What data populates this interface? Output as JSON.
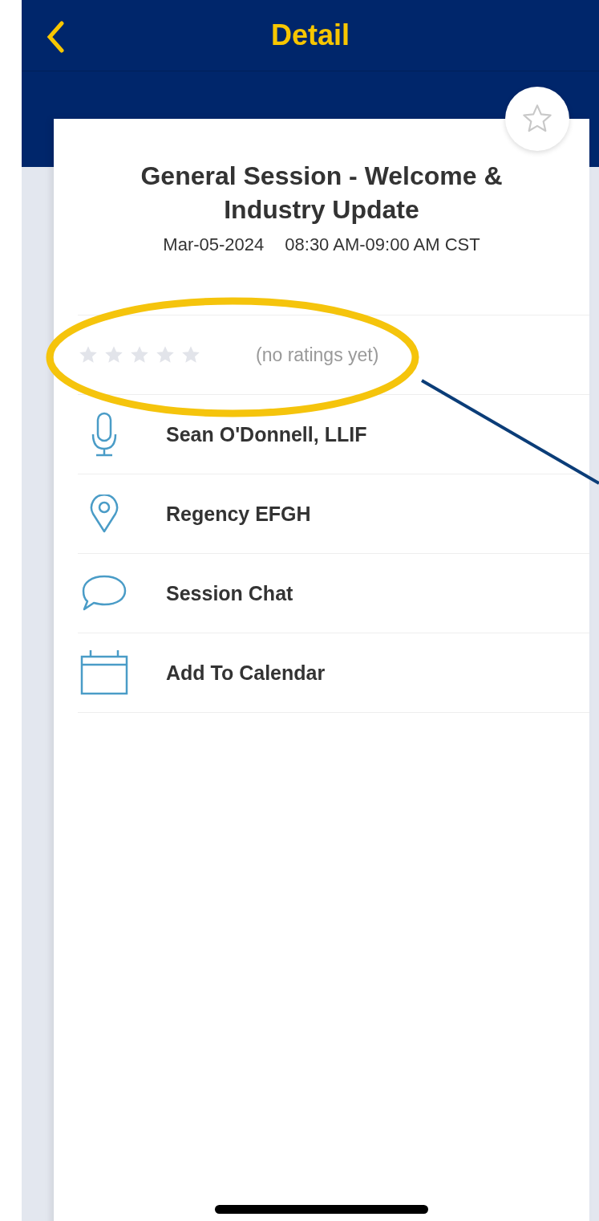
{
  "nav": {
    "title": "Detail"
  },
  "favorite": {
    "selected": false
  },
  "session": {
    "title": "General Session - Welcome & Industry Update",
    "date": "Mar-05-2024",
    "time": "08:30 AM-09:00 AM CST"
  },
  "rating": {
    "stars": 0,
    "note": "(no ratings yet)"
  },
  "rows": [
    {
      "kind": "speaker",
      "label": "Sean O'Donnell, LLIF"
    },
    {
      "kind": "location",
      "label": "Regency EFGH"
    },
    {
      "kind": "chat",
      "label": "Session Chat"
    },
    {
      "kind": "calendar",
      "label": "Add To Calendar"
    }
  ]
}
